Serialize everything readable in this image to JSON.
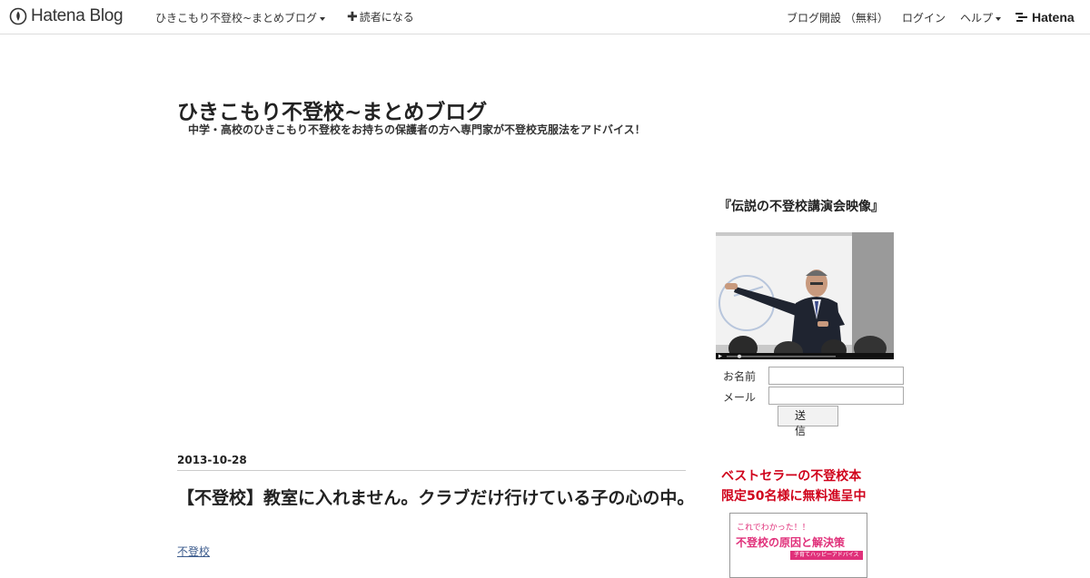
{
  "topbar": {
    "brand": "Hatena Blog",
    "blog_menu": "ひきこもり不登校~まとめブログ",
    "follow": "読者になる",
    "signup": "ブログ開設 （無料）",
    "login": "ログイン",
    "help": "ヘルプ",
    "hatena": "Hatena"
  },
  "header": {
    "title": "ひきこもり不登校~まとめブログ",
    "description": "中学・高校のひきこもり不登校をお持ちの保護者の方へ専門家が不登校克服法をアドバイス！"
  },
  "entry": {
    "date": "2013-10-28",
    "title": "【不登校】教室に入れません。クラブだけ行けている子の心の中。",
    "category": "不登校"
  },
  "sidebar": {
    "video_heading": "『伝説の不登校講演会映像』",
    "form": {
      "name_label": "お名前",
      "mail_label": "メール",
      "submit_label": "送信"
    },
    "promo_line1": "ベストセラーの不登校本",
    "promo_line2": "限定50名様に無料進呈中",
    "book": {
      "line1": "これでわかった！！",
      "line2": "不登校の原因と解決策",
      "badge": "子育てハッピーアドバイス"
    }
  }
}
